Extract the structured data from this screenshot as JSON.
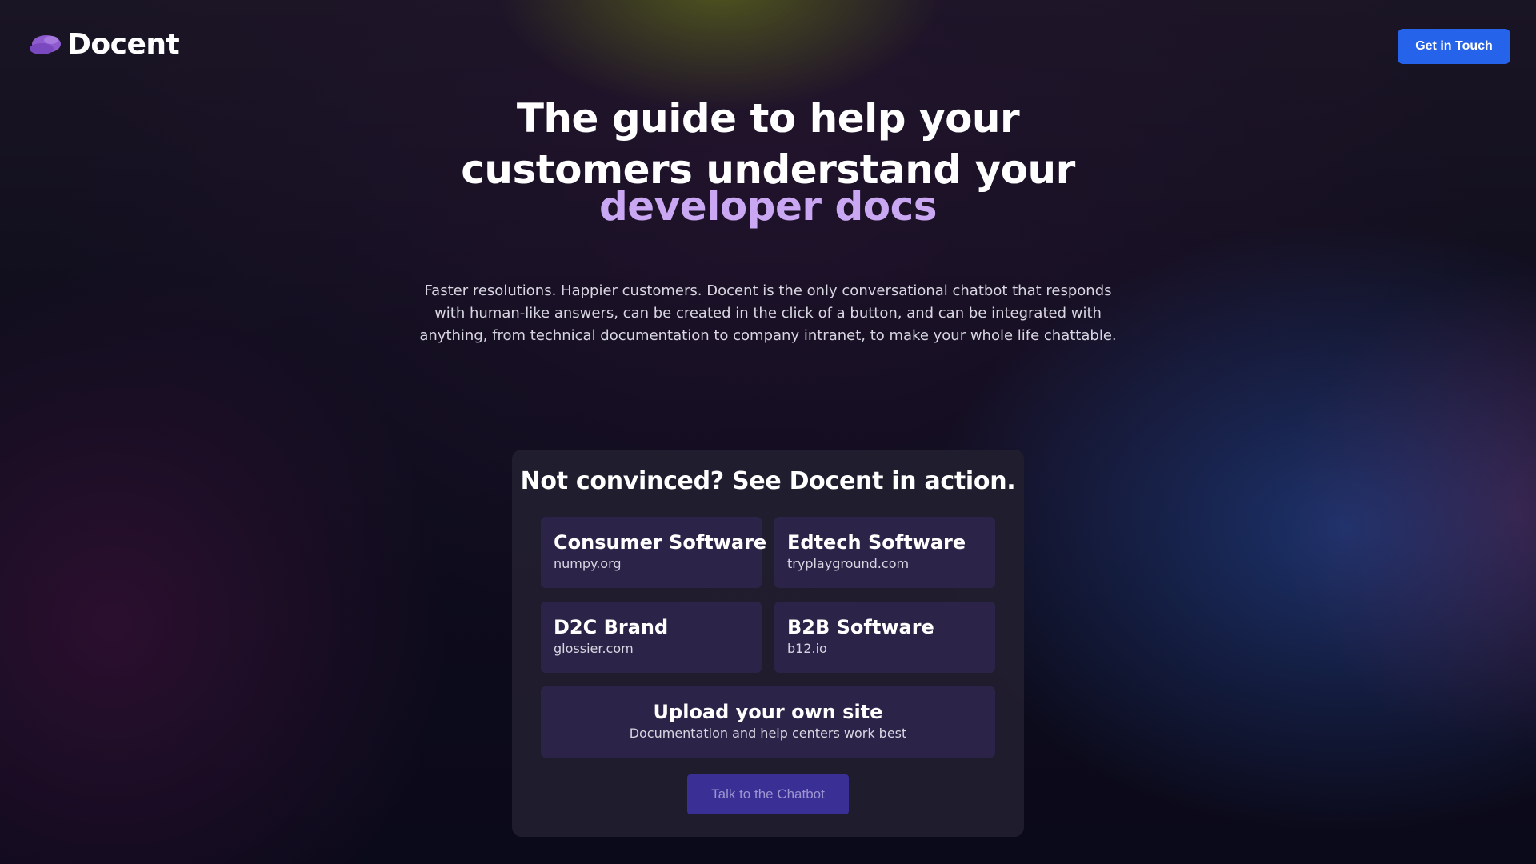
{
  "header": {
    "brand": "Docent",
    "logo_icon": "beret-icon",
    "cta_label": "Get in Touch"
  },
  "hero": {
    "title_line1": "The guide to help your",
    "title_line2": "customers understand your",
    "title_accent": "developer docs",
    "description": "Faster resolutions. Happier customers. Docent is the only conversational chatbot that responds with human-like answers, can be created in the click of a button, and can be integrated with anything, from technical documentation to company intranet, to make your whole life chattable."
  },
  "demo": {
    "title": "Not convinced? See Docent in action.",
    "options": [
      {
        "title": "Consumer Software",
        "subtitle": "numpy.org"
      },
      {
        "title": "Edtech Software",
        "subtitle": "tryplayground.com"
      },
      {
        "title": "D2C Brand",
        "subtitle": "glossier.com"
      },
      {
        "title": "B2B Software",
        "subtitle": "b12.io"
      }
    ],
    "upload": {
      "title": "Upload your own site",
      "subtitle": "Documentation and help centers work best"
    },
    "talk_label": "Talk to the Chatbot"
  },
  "colors": {
    "accent_purple": "#c9a7f2",
    "cta_blue": "#2563eb",
    "talk_button": "#3a2f95",
    "option_bg": "#2c2448"
  }
}
